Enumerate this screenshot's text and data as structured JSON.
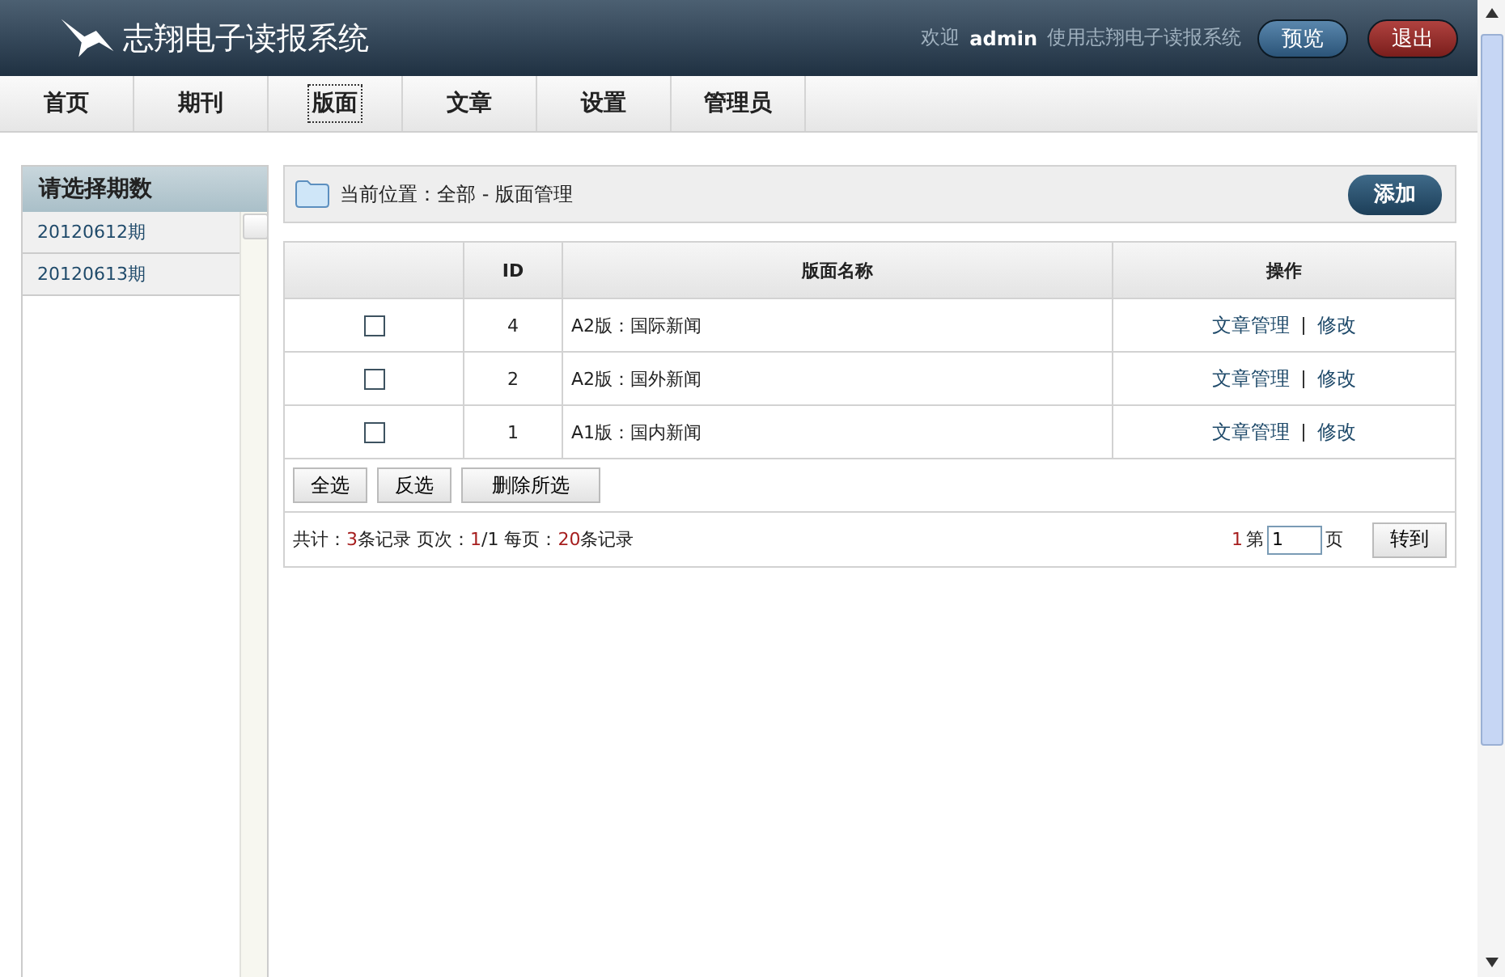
{
  "header": {
    "title": "志翔电子读报系统",
    "welcome": "欢迎",
    "user": "admin",
    "welcome_tail": "使用志翔电子读报系统",
    "buttons": [
      {
        "label": "预览",
        "kind": "preview"
      },
      {
        "label": "退出",
        "kind": "logout"
      }
    ]
  },
  "nav": [
    {
      "label": "首页",
      "selected": false
    },
    {
      "label": "期刊",
      "selected": false
    },
    {
      "label": "版面",
      "selected": true
    },
    {
      "label": "文章",
      "selected": false
    },
    {
      "label": "设置",
      "selected": false
    },
    {
      "label": "管理员",
      "selected": false
    }
  ],
  "sidebar": {
    "title": "请选择期数",
    "items": [
      "20120612期",
      "20120613期"
    ]
  },
  "breadcrumb": {
    "text": "当前位置：全部 - 版面管理",
    "add_button": "添加"
  },
  "table": {
    "columns": [
      "",
      "ID",
      "版面名称",
      "操作"
    ],
    "rows": [
      {
        "checked": false,
        "id": "4",
        "name": "A2版：国际新闻",
        "actions": [
          "文章管理",
          "修改"
        ]
      },
      {
        "checked": false,
        "id": "2",
        "name": "A2版：国外新闻",
        "actions": [
          "文章管理",
          "修改"
        ]
      },
      {
        "checked": false,
        "id": "1",
        "name": "A1版：国内新闻",
        "actions": [
          "文章管理",
          "修改"
        ]
      }
    ],
    "buttons": [
      "全选",
      "反选",
      "删除所选"
    ]
  },
  "pager": {
    "summary": [
      {
        "text": "共计：",
        "highlight": false
      },
      {
        "text": "3",
        "highlight": true
      },
      {
        "text": "条记录 页次：",
        "highlight": false
      },
      {
        "text": "1",
        "highlight": true
      },
      {
        "text": "/1 每页：",
        "highlight": false
      },
      {
        "text": "20",
        "highlight": true
      },
      {
        "text": "条记录",
        "highlight": false
      }
    ],
    "current": "1",
    "page_label": "第",
    "page_value": "1",
    "page_unit": "页",
    "go_button": "转到"
  }
}
